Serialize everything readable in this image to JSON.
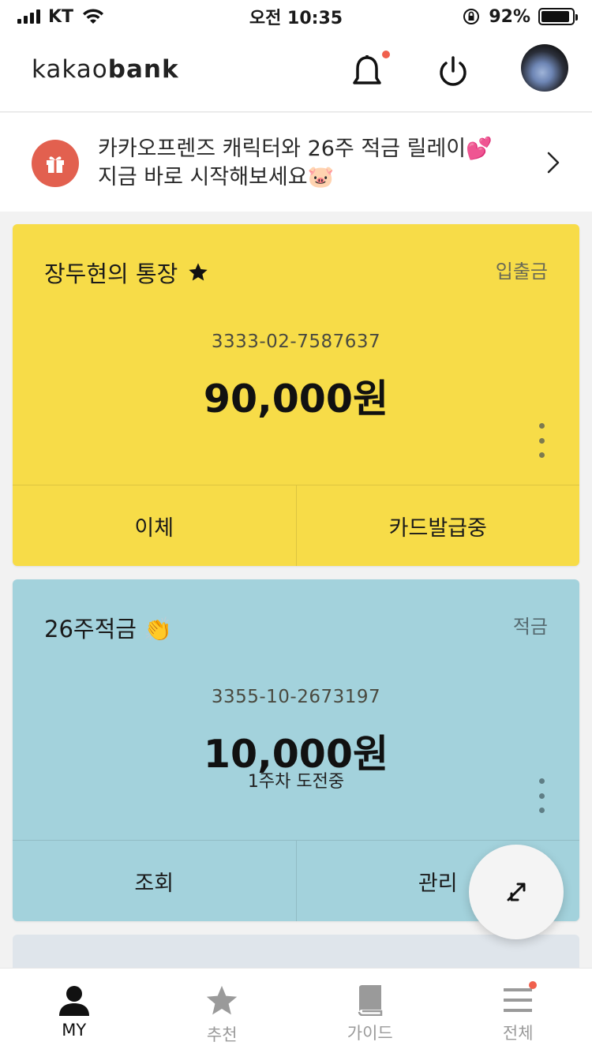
{
  "status_bar": {
    "carrier": "KT",
    "time": "오전 10:35",
    "battery_text": "92%",
    "battery_level": 0.92
  },
  "header": {
    "logo_light": "kakao",
    "logo_bold": "bank",
    "notification_dot_color": "#f0604d"
  },
  "promo": {
    "line1": "카카오프렌즈 캐릭터와 26주 적금 릴레이💕",
    "line2": "지금 바로 시작해보세요🐷",
    "icon": "gift-icon",
    "icon_bg": "#e2604f"
  },
  "accounts": [
    {
      "name": "장두현의 통장",
      "type": "입출금",
      "number": "3333-02-7587637",
      "balance": "90,000원",
      "actions": [
        "이체",
        "카드발급중"
      ],
      "color": "#f7dc48"
    },
    {
      "name": "26주적금 👏",
      "type": "적금",
      "number": "3355-10-2673197",
      "balance": "10,000원",
      "status": "1주차 도전중",
      "actions": [
        "조회",
        "관리"
      ],
      "color": "#a3d2dc"
    }
  ],
  "tabs": [
    {
      "label": "MY",
      "icon": "person-icon",
      "active": true
    },
    {
      "label": "추천",
      "icon": "star-icon",
      "active": false
    },
    {
      "label": "가이드",
      "icon": "book-icon",
      "active": false
    },
    {
      "label": "전체",
      "icon": "menu-icon",
      "active": false
    }
  ]
}
